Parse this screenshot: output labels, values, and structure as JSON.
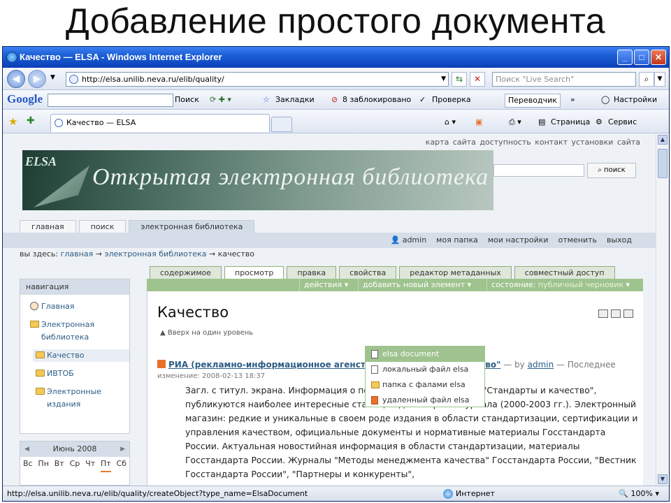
{
  "slide": {
    "title": "Добавление простого документа"
  },
  "window": {
    "title": "Качество — ELSA - Windows Internet Explorer"
  },
  "address_bar": {
    "url": "http://elsa.unilib.neva.ru/elib/quality/",
    "search_placeholder": "Поиск \"Live Search\""
  },
  "google_toolbar": {
    "logo": "Google",
    "search_btn": "Поиск",
    "bookmarks": "Закладки",
    "blocked": "8 заблокировано",
    "check": "Проверка",
    "translator": "Переводчик",
    "settings": "Настройки"
  },
  "tab_bar": {
    "tab_title": "Качество — ELSA",
    "page_menu": "Страница",
    "service_menu": "Сервис"
  },
  "site": {
    "top_links": "карта сайта   доступность   контакт   установки сайта",
    "banner_logo": "ELSA",
    "banner_text": "Открытая электронная библиотека",
    "search_button": "поиск",
    "top_tabs": [
      "главная",
      "поиск",
      "электронная библиотека"
    ],
    "user_bar": [
      "admin",
      "моя папка",
      "мои настройки",
      "отменить",
      "выход"
    ],
    "breadcrumb": {
      "prefix": "вы здесь:",
      "items": [
        "главная",
        "электронная библиотека",
        "качество"
      ],
      "separator": "→"
    },
    "navigation": {
      "title": "навигация",
      "items": [
        {
          "label": "Главная"
        },
        {
          "label": "Электронная библиотека"
        },
        {
          "label": "Качество"
        },
        {
          "label": "ИВТОБ"
        },
        {
          "label": "Электронные издания"
        }
      ]
    },
    "calendar": {
      "month": "Июнь 2008",
      "days": [
        "Вс",
        "Пн",
        "Вт",
        "Ср",
        "Чт",
        "Пт",
        "Сб"
      ],
      "today": "Пт"
    },
    "content_tabs": [
      "содержимое",
      "просмотр",
      "правка",
      "свойства",
      "редактор метаданных",
      "совместный доступ"
    ],
    "actions": {
      "actions": "действия",
      "add_new": "добавить новый элемент",
      "state_label": "состояние:",
      "state_value": "публичный черновик"
    },
    "add_menu": [
      "elsa document",
      "локальный файл elsa",
      "папка с фалами elsa",
      "удаленный файл elsa"
    ],
    "page_title": "Качество",
    "up_level": "Вверх на один уровень",
    "item": {
      "title": "РИА (рекламно-информационное агенство) \"Стандарты и качество\"",
      "by_prefix": "— by",
      "author": "admin",
      "modified_label": "— Последнее",
      "modified_line": "изменение: 2008-02-13 18:37",
      "description": "Загл. с титул. экрана. Информация о популярных изданиях РИА \"Стандарты и качество\", публикуются наиболее интересные статьи, ведется архив журнала (2000-2003 гг.). Электронный магазин: редкие и уникальные в своем роде издания в области стандартизации, сертификации и управления качеством, официальные документы и нормативные материалы Госстандарта России. Актуальная новостийная информация в области стандартизации, материалы Госстандарта России. Журналы \"Методы менеджмента качества\" Госстандарта России, \"Вестник Госстандарта России\", \"Партнеры и конкуренты\","
    }
  },
  "statusbar": {
    "url": "http://elsa.unilib.neva.ru/elib/quality/createObject?type_name=ElsaDocument",
    "zone": "Интернет",
    "zoom": "100%"
  }
}
